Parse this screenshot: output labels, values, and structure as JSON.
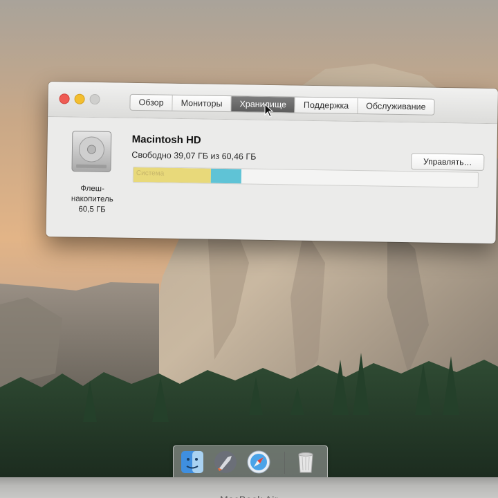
{
  "window": {
    "tabs": [
      {
        "label": "Обзор",
        "active": false
      },
      {
        "label": "Мониторы",
        "active": false
      },
      {
        "label": "Хранилище",
        "active": true
      },
      {
        "label": "Поддержка",
        "active": false
      },
      {
        "label": "Обслуживание",
        "active": false
      }
    ]
  },
  "storage": {
    "disk_name": "Macintosh HD",
    "free_text": "Свободно 39,07 ГБ из 60,46 ГБ",
    "manage_label": "Управлять…",
    "device_caption": [
      "Флеш-",
      "накопитель",
      "60,5 ГБ"
    ],
    "usage_segments": [
      {
        "label": "Система",
        "fraction": 0.225,
        "color": "#e8d97a"
      },
      {
        "label": "",
        "fraction": 0.088,
        "color": "#5fc3d6"
      }
    ]
  },
  "dock": {
    "items": [
      "finder-icon",
      "launchpad-icon",
      "safari-icon",
      "trash-icon"
    ]
  },
  "device": {
    "model_label": "MacBook Air"
  },
  "colors": {
    "active_tab": "#656565",
    "close": "#ef5b53",
    "minimize": "#f3be2f"
  }
}
